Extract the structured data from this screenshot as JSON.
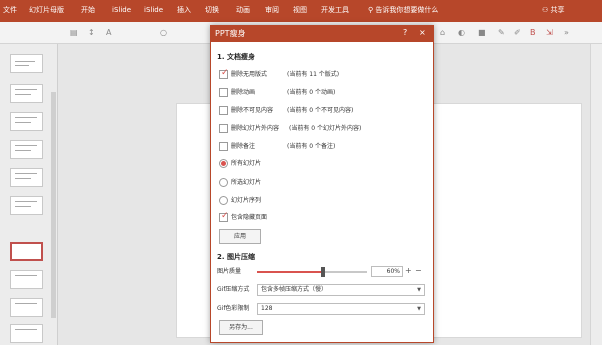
{
  "ribbon": {
    "tabs": [
      "文件",
      "幻灯片母版",
      "开始",
      "iSlide",
      "iSlide",
      "插入",
      "切换",
      "动画",
      "审阅",
      "视图",
      "开发工具"
    ],
    "tell_me": "告诉我你想要做什么",
    "share": "共享"
  },
  "dialog": {
    "title": "PPT瘦身",
    "help": "?",
    "close": "×",
    "section1": "1. 文档瘦身",
    "options": [
      {
        "label": "删除无用版式",
        "note": "(当前有 11 个版式)",
        "checked": true
      },
      {
        "label": "删除动画",
        "note": "(当前有 0 个动画)",
        "checked": false
      },
      {
        "label": "删除不可见内容",
        "note": "(当前有 0 个不可见内容)",
        "checked": false
      },
      {
        "label": "删除幻灯片外内容",
        "note": "(当前有 0 个幻灯片外内容)",
        "checked": false
      },
      {
        "label": "删除备注",
        "note": "(当前有 0 个备注)",
        "checked": false
      }
    ],
    "scope": [
      {
        "label": "所有幻灯片",
        "selected": true
      },
      {
        "label": "所选幻灯片",
        "selected": false
      },
      {
        "label": "幻灯片序列",
        "selected": false
      }
    ],
    "include_hidden": {
      "label": "包含隐藏页面",
      "checked": true
    },
    "apply_label": "应用",
    "section2": "2. 图片压缩",
    "quality_label": "图片质量",
    "quality_value": "60%",
    "quality_level": 0.6,
    "gif_mode_label": "Gif压缩方式",
    "gif_mode_value": "包含多帧压缩方式（慢）",
    "gif_limit_label": "Gif色彩限制",
    "gif_limit_value": "128",
    "saveas_label": "另存为..."
  },
  "colors": {
    "accent": "#b7472a",
    "check": "#d9534f"
  }
}
